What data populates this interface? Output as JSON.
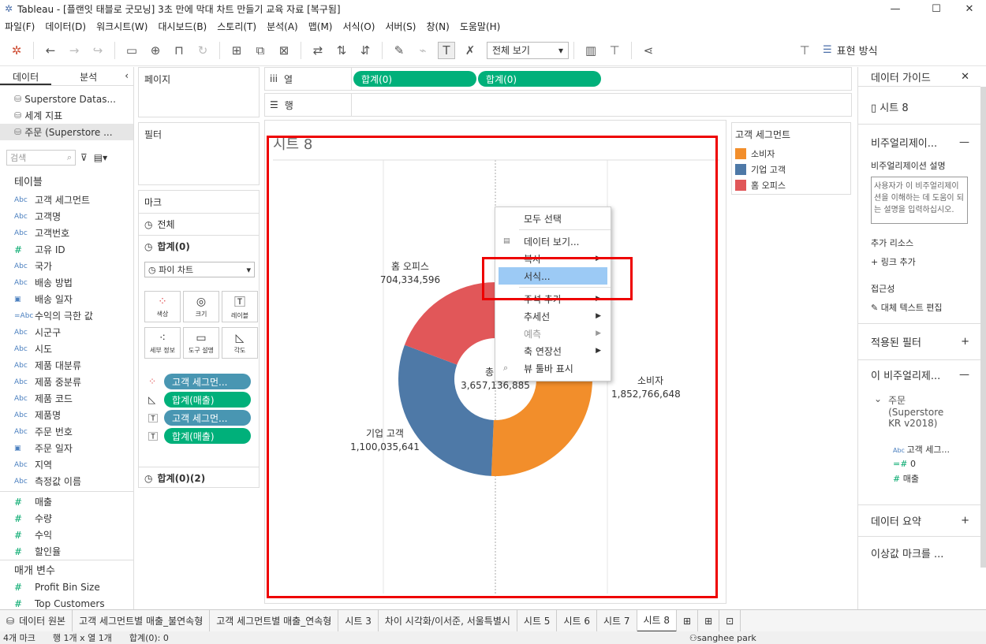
{
  "window": {
    "title": "Tableau - [플랜잇 태블로 굿모닝] 3초 만에 막대 차트 만들기 교육 자료 [복구됨]"
  },
  "menu": [
    "파일(F)",
    "데이터(D)",
    "워크시트(W)",
    "대시보드(B)",
    "스토리(T)",
    "분석(A)",
    "맵(M)",
    "서식(O)",
    "서버(S)",
    "창(N)",
    "도움말(H)"
  ],
  "toolbar": {
    "view_dropdown": "전체 보기",
    "show_me": "표현 방식"
  },
  "left": {
    "tab_data": "데이터",
    "tab_analysis": "분석",
    "datasources": [
      "Superstore Datas...",
      "세계 지표",
      "주문 (Superstore ..."
    ],
    "search_placeholder": "검색",
    "tables_header": "테이블",
    "dims": [
      {
        "t": "Abc",
        "n": "고객 세그먼트"
      },
      {
        "t": "Abc",
        "n": "고객명"
      },
      {
        "t": "Abc",
        "n": "고객번호"
      },
      {
        "t": "#",
        "n": "고유 ID"
      },
      {
        "t": "Abc",
        "n": "국가"
      },
      {
        "t": "Abc",
        "n": "배송 방법"
      },
      {
        "t": "cal",
        "n": "배송 일자"
      },
      {
        "t": "=Abc",
        "n": "수익의 극한 값"
      },
      {
        "t": "Abc",
        "n": "시군구"
      },
      {
        "t": "Abc",
        "n": "시도"
      },
      {
        "t": "Abc",
        "n": "제품 대분류"
      },
      {
        "t": "Abc",
        "n": "제품 중분류"
      },
      {
        "t": "Abc",
        "n": "제품 코드"
      },
      {
        "t": "Abc",
        "n": "제품명"
      },
      {
        "t": "Abc",
        "n": "주문 번호"
      },
      {
        "t": "cal",
        "n": "주문 일자"
      },
      {
        "t": "Abc",
        "n": "지역"
      },
      {
        "t": "Abc",
        "n": "측정값 이름"
      }
    ],
    "measures": [
      "매출",
      "수량",
      "수익",
      "할인율"
    ],
    "params_header": "매개 변수",
    "params": [
      "Profit Bin Size",
      "Top Customers"
    ]
  },
  "shelves": {
    "pages": "페이지",
    "filters": "필터",
    "marks": "마크",
    "columns": "열",
    "rows": "행",
    "col_pills": [
      "합계(0)",
      "합계(0)"
    ]
  },
  "marks": {
    "all": "전체",
    "sum0": "합계(0)",
    "mark_type": "파이 차트",
    "buttons": [
      "색상",
      "크기",
      "레이블",
      "세부 정보",
      "도구 설명",
      "각도"
    ],
    "pills": [
      "고객 세그먼...",
      "합계(매출)",
      "고객 세그먼...",
      "합계(매출)"
    ],
    "sum02": "합계(0)(2)"
  },
  "sheet": {
    "title": "시트 8"
  },
  "legend": {
    "title": "고객 세그먼트",
    "items": [
      {
        "label": "소비자",
        "color": "#F28E2B"
      },
      {
        "label": "기업 고객",
        "color": "#4E79A7"
      },
      {
        "label": "홈 오피스",
        "color": "#E15759"
      }
    ]
  },
  "chart_data": {
    "type": "pie",
    "categories": [
      "소비자",
      "기업 고객",
      "홈 오피스"
    ],
    "values": [
      1852766648,
      1100035641,
      704334596
    ],
    "value_labels": [
      "1,852,766,648",
      "1,100,035,641",
      "704,334,596"
    ],
    "center_label": "총 매",
    "center_value": "3,657,136,885",
    "colors": [
      "#F28E2B",
      "#4E79A7",
      "#E15759"
    ]
  },
  "context_menu": [
    "모두 선택",
    "데이터 보기...",
    "복사",
    "서식...",
    "주석 추가",
    "추세선",
    "예측",
    "축 연장선",
    "뷰 툴바 표시"
  ],
  "right": {
    "header": "데이터 가이드",
    "sheet": "시트 8",
    "viz_desc": "비주얼리제이...",
    "desc_label": "비주얼리제이션 설명",
    "desc_placeholder": "사용자가 이 비주얼리제이션을 이해하는 데 도움이 되는 설명을 입력하십시오.",
    "resources": "추가 리소스",
    "add_link": "링크 추가",
    "access": "접근성",
    "alt_text": "대체 텍스트 편집",
    "filters": "적용된 필터",
    "this_viz": "이 비주얼리제...",
    "source": "주문 (Superstore KR v2018)",
    "fields": [
      "고객 세그...",
      "0",
      "매출"
    ],
    "summary": "데이터 요약",
    "outliers": "이상값 마크를 ..."
  },
  "tabs": [
    "데이터 원본",
    "고객 세그먼트별 매출_불연속형",
    "고객 세그먼트별 매출_연속형",
    "시트 3",
    "차이 시각화/이서준, 서울특별시",
    "시트 5",
    "시트 6",
    "시트 7",
    "시트 8"
  ],
  "status": {
    "marks": "4개 마크",
    "rows": "행 1개 x 열 1개",
    "sum": "합계(0): 0",
    "user": "sanghee park"
  }
}
